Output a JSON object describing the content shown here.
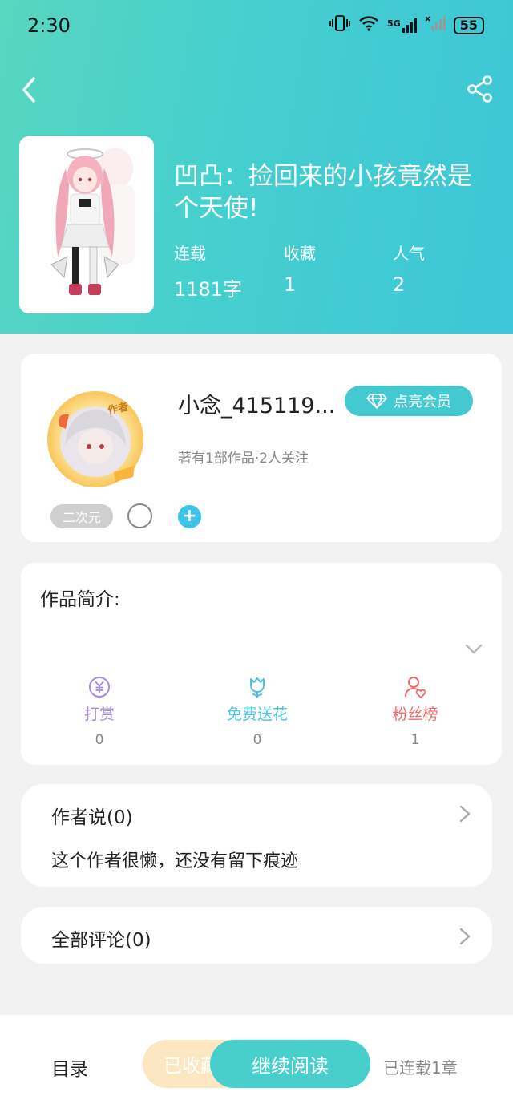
{
  "status_bar": {
    "time": "2:30",
    "network": "5G",
    "battery": "55"
  },
  "book": {
    "title": "凹凸：捡回来的小孩竟然是个天使!",
    "stats": [
      {
        "label": "连载",
        "value": "1181字"
      },
      {
        "label": "收藏",
        "value": "1"
      },
      {
        "label": "人气",
        "value": "2"
      }
    ]
  },
  "author": {
    "badge": "作者",
    "name": "小念_415119...",
    "vip_label": "点亮会员",
    "meta": "著有1部作品·2人关注",
    "tag": "二次元"
  },
  "intro": {
    "title": "作品简介:",
    "actions": [
      {
        "label": "打赏",
        "count": "0",
        "icon": "yen-icon",
        "color": "#a78be0"
      },
      {
        "label": "免费送花",
        "count": "0",
        "icon": "flower-icon",
        "color": "#4cc4e0"
      },
      {
        "label": "粉丝榜",
        "count": "1",
        "icon": "fan-icon",
        "color": "#ec6b6b"
      }
    ]
  },
  "author_says": {
    "title": "作者说(0)",
    "text": "这个作者很懒，还没有留下痕迹"
  },
  "comments": {
    "title": "全部评论(0)"
  },
  "bottom_bar": {
    "toc_label": "目录",
    "fav_label": "已收藏",
    "read_label": "继续阅读",
    "chapters_label": "已连载1章"
  },
  "colors": {
    "accent": "#43c9cf",
    "header_start": "#58d6c0",
    "header_end": "#3dc6d8"
  }
}
